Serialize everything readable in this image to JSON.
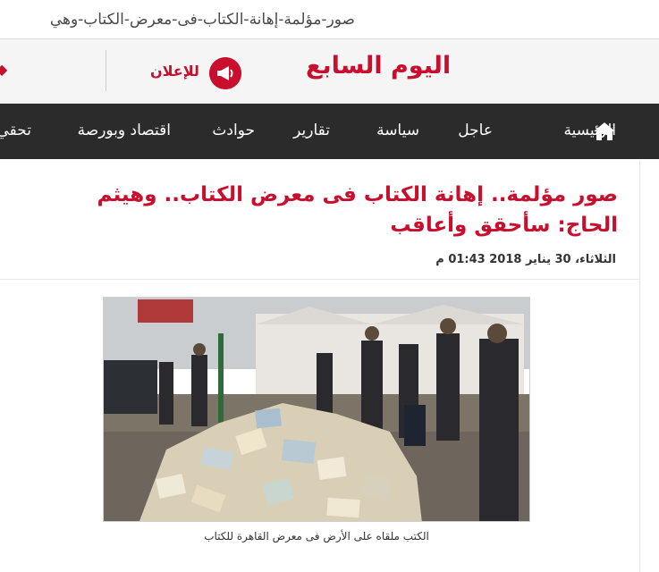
{
  "browser": {
    "url": "صور-مؤلمة-إهانة-الكتاب-فى-معرض-الكتاب-وهي"
  },
  "header": {
    "logo_text": "اليوم السابع",
    "ad_label": "للإعلان"
  },
  "nav": {
    "items": [
      "الرئيسية",
      "عاجل",
      "سياسة",
      "تقارير",
      "حوادث",
      "اقتصاد وبورصة",
      "تحقي"
    ]
  },
  "article": {
    "title": "صور مؤلمة.. إهانة الكتاب فى معرض الكتاب.. وهيثم الحاج: سأحقق وأعاقب",
    "date": "الثلاثاء، 30 يناير 2018 01:43 م",
    "caption": "الكتب ملقاه على الأرض فى معرض القاهرة للكتاب"
  },
  "colors": {
    "brand": "#c8102e",
    "nav_bg": "#2b2b2b"
  }
}
